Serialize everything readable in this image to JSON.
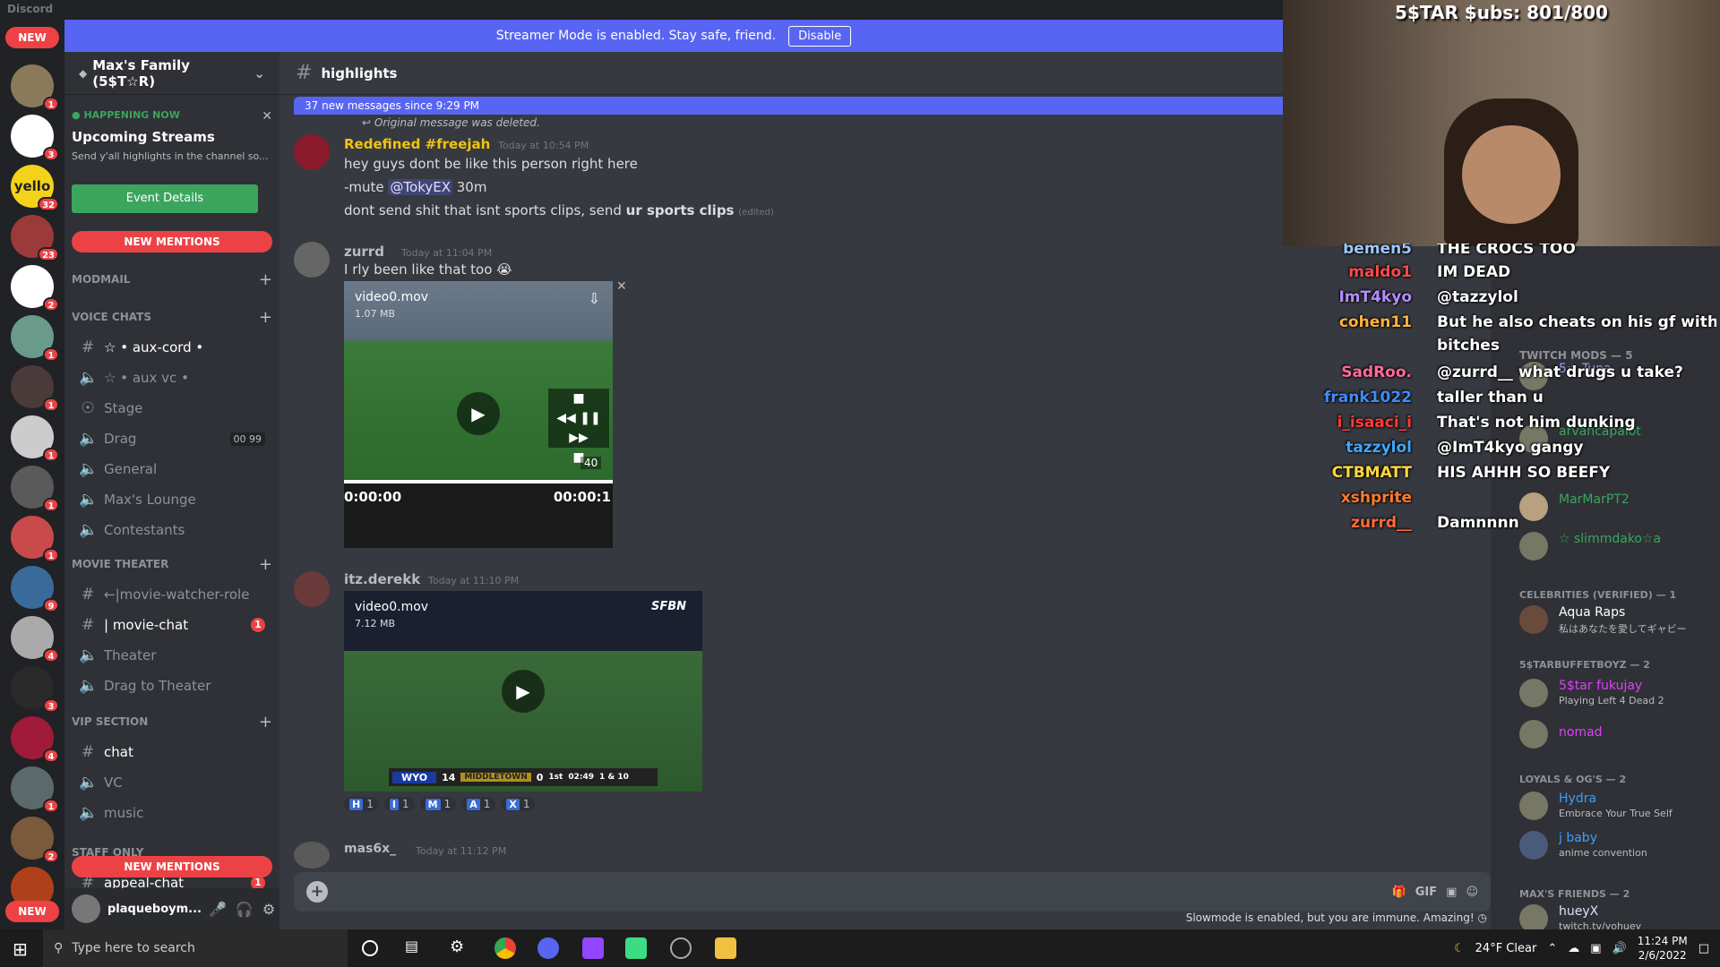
{
  "window": {
    "title": "Discord"
  },
  "streamer": {
    "text": "Streamer Mode is enabled. Stay safe, friend.",
    "disable_label": "Disable"
  },
  "guilds": {
    "new_top": "NEW",
    "new_bottom": "NEW",
    "yello_label": "yello",
    "badges": [
      "1",
      "1",
      "3",
      "32",
      "23",
      "2",
      "1",
      "1",
      "1",
      "1",
      "1",
      "9",
      "4",
      "3",
      "4",
      "1",
      "2"
    ]
  },
  "server": {
    "name": "Max's Family (5$T☆R)"
  },
  "event": {
    "status": "HAPPENING NOW",
    "title": "Upcoming Streams",
    "desc": "Send y'all highlights in the channel so...",
    "button": "Event Details"
  },
  "new_mentions_top": "NEW MENTIONS",
  "new_mentions_bottom": "NEW MENTIONS",
  "categories": {
    "modmail": "MODMAIL",
    "voice": "VOICE CHATS",
    "movie": "MOVIE THEATER",
    "vip": "VIP SECTION",
    "staff": "STAFF ONLY"
  },
  "channels": {
    "aux_cord": "☆ • aux-cord •",
    "aux_vc": "☆ • aux vc •",
    "stage": "Stage",
    "drag": "Drag",
    "drag_time1": "00",
    "drag_time2": "99",
    "general": "General",
    "max_lounge": "Max's Lounge",
    "contestants": "Contestants",
    "watcher_role": "←|movie-watcher-role",
    "movie_chat": "| movie-chat",
    "movie_chat_badge": "1",
    "theater": "Theater",
    "drag_theater": "Drag to Theater",
    "chat": "chat",
    "vc": "VC",
    "music": "music",
    "appeal": "appeal-chat",
    "appeal_badge": "1"
  },
  "user": {
    "name": "plaqueboym..."
  },
  "chat": {
    "channel": "highlights",
    "new_messages": "37 new messages since 9:29 PM",
    "deleted": "Original message was deleted.",
    "m1": {
      "author": "Redefined #freejah",
      "time": "Today at 10:54 PM",
      "line1": "hey guys dont be like this person right here",
      "line2_pre": "-mute ",
      "line2_mention": "@TokyEX",
      "line2_post": " 30m",
      "line3_pre": "dont send shit that isnt sports clips, send ",
      "line3_bold": "ur sports clips",
      "edited": "(edited)"
    },
    "m2": {
      "author": "zurrd",
      "time": "Today at 11:04 PM",
      "text": "I rly been like that too 😭",
      "video": "video0.mov",
      "size": "1.07 MB",
      "time_start": "0:00:00",
      "time_end": "00:00:1",
      "counter": "40"
    },
    "m3": {
      "author": "itz.derekk",
      "time": "Today at 11:10 PM",
      "video": "video0.mov",
      "size": "7.12 MB",
      "logo": "SFBN",
      "score": {
        "t1": "WYO",
        "s1": "14",
        "t2": "MIDDLETOWN",
        "s2": "0",
        "q": "1st",
        "clock": "02:49",
        "down": "1 & 10"
      }
    },
    "reactions": [
      {
        "l": "H",
        "c": "1"
      },
      {
        "l": "I",
        "c": "1"
      },
      {
        "l": "M",
        "c": "1"
      },
      {
        "l": "A",
        "c": "1"
      },
      {
        "l": "X",
        "c": "1"
      }
    ],
    "m4": {
      "author": "mas6x_",
      "time": "Today at 11:12 PM"
    },
    "composer_placeholder": "",
    "composer_icons": {
      "gif": "GIF"
    },
    "slowmode": "Slowmode is enabled, but you are immune. Amazing!"
  },
  "members": {
    "mods": "TWITCH MODS — 5",
    "mod_names": [
      "5☆ Tuna",
      "arvancapalot",
      "MarMarPT2",
      "☆ slimmdako☆a"
    ],
    "celeb": "CELEBRITIES (VERIFIED) — 1",
    "celeb_name": "Aqua Raps",
    "celeb_sub": "私はあなたを愛してギャビー",
    "buffet": "5$TARBUFFETBOYZ — 2",
    "buffet1": "5$tar fukujay",
    "buffet1_sub": "Playing Left 4 Dead 2",
    "buffet2": "nomad",
    "loyals": "LOYALS & OG'S — 2",
    "loyal1": "Hydra",
    "loyal1_sub": "Embrace Your True Self",
    "loyal2": "j baby",
    "loyal2_sub": "anime convention",
    "friends": "MAX'S FRIENDS — 2",
    "friend1": "hueyX",
    "friend1_sub": "twitch.tv/yohuey"
  },
  "webcam": {
    "subgoal": "5$TAR $ubs: 801/800"
  },
  "twitch_chat": [
    {
      "who": "bemen5",
      "text": "THE CROCS TOO",
      "color": "#9ec7ff"
    },
    {
      "who": "maldo1",
      "text": "IM DEAD",
      "color": "#ff4a4a"
    },
    {
      "who": "ImT4kyo",
      "text": "@tazzylol",
      "color": "#b48cff"
    },
    {
      "who": "cohen11",
      "text": "But he also cheats on his gf with ugly",
      "text2": "bitches",
      "color": "#ffb13b"
    },
    {
      "who": "SadRoo.",
      "text": "@zurrd__ what drugs u take?",
      "color": "#ff6b9a"
    },
    {
      "who": "frank1022",
      "text": "taller than u",
      "color": "#3f8cff"
    },
    {
      "who": "i_isaaci_i",
      "text": "That's not him dunking",
      "color": "#ff3b3b"
    },
    {
      "who": "tazzylol",
      "text": "@ImT4kyo gangy",
      "color": "#3fa8ff"
    },
    {
      "who": "CTBMATT",
      "text": "HIS AHHH SO BEEFY",
      "color": "#ffd83b"
    },
    {
      "who": "xshprite",
      "text": "",
      "color": "#ff7a2f"
    },
    {
      "who": "zurrd__",
      "text": "Damnnnn",
      "color": "#ff6a3b"
    }
  ],
  "taskbar": {
    "search": "Type here to search",
    "weather": "24°F  Clear",
    "time": "11:24 PM",
    "date": "2/6/2022"
  },
  "colors": {
    "blurple": "#5865f2",
    "green": "#3ba55d",
    "red": "#ed4245"
  }
}
